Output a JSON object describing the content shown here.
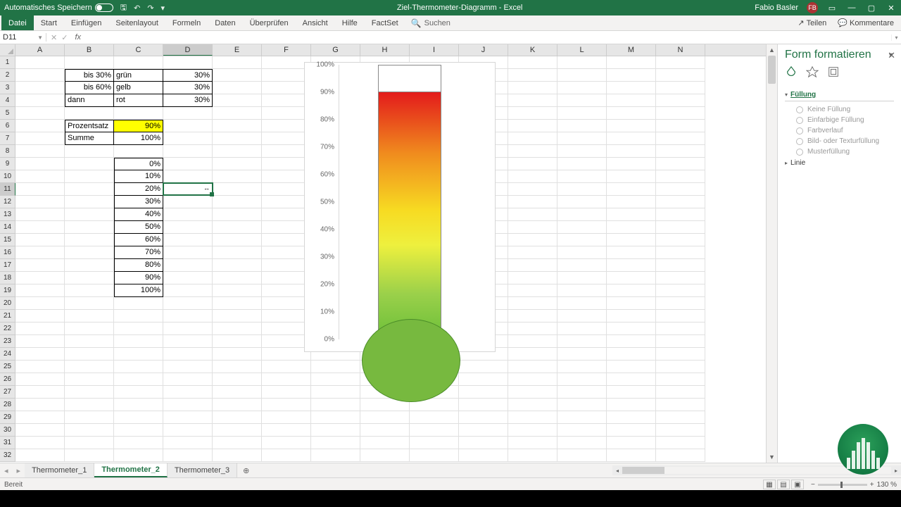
{
  "titlebar": {
    "autosave": "Automatisches Speichern",
    "doc_title": "Ziel-Thermometer-Diagramm - Excel",
    "user": "Fabio Basler",
    "user_initials": "FB"
  },
  "ribbon": {
    "tabs": [
      "Datei",
      "Start",
      "Einfügen",
      "Seitenlayout",
      "Formeln",
      "Daten",
      "Überprüfen",
      "Ansicht",
      "Hilfe",
      "FactSet"
    ],
    "search": "Suchen",
    "share": "Teilen",
    "comments": "Kommentare"
  },
  "fbar": {
    "namebox": "D11",
    "formula": ""
  },
  "columns": [
    "A",
    "B",
    "C",
    "D",
    "E",
    "F",
    "G",
    "H",
    "I",
    "J",
    "K",
    "L",
    "M",
    "N"
  ],
  "sheet_rows": 32,
  "cells": {
    "B2": "bis 30%",
    "C2": "grün",
    "D2": "30%",
    "B3": "bis 60%",
    "C3": "gelb",
    "D3": "30%",
    "B4": "dann",
    "C4": "rot",
    "D4": "30%",
    "B6": "Prozentsatz",
    "C6": "90%",
    "B7": "Summe",
    "C7": "100%",
    "C9": "0%",
    "C10": "10%",
    "C11": "20%",
    "C12": "30%",
    "C13": "40%",
    "C14": "50%",
    "C15": "60%",
    "C16": "70%",
    "C17": "80%",
    "C18": "90%",
    "C19": "100%"
  },
  "chart_data": {
    "type": "bar",
    "categories": [
      ""
    ],
    "values": [
      90
    ],
    "ylabel": "",
    "ylim": [
      0,
      100
    ],
    "yticks": [
      "0%",
      "10%",
      "20%",
      "30%",
      "40%",
      "50%",
      "60%",
      "70%",
      "80%",
      "90%",
      "100%"
    ]
  },
  "panel": {
    "title": "Form formatieren",
    "section_fill": "Füllung",
    "options": [
      "Keine Füllung",
      "Einfarbige Füllung",
      "Farbverlauf",
      "Bild- oder Texturfüllung",
      "Musterfüllung"
    ],
    "section_line": "Linie"
  },
  "sheets": {
    "tabs": [
      "Thermometer_1",
      "Thermometer_2",
      "Thermometer_3"
    ],
    "active": 1
  },
  "status": {
    "ready": "Bereit",
    "zoom": "130 %"
  }
}
